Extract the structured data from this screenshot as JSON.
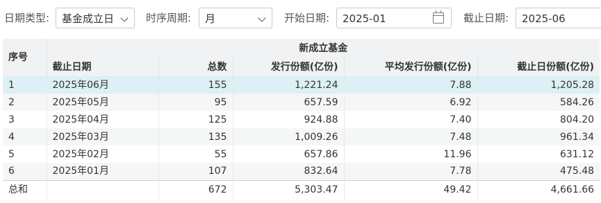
{
  "filters": {
    "date_type_label": "日期类型:",
    "date_type_value": "基金成立日",
    "period_label": "时序周期:",
    "period_value": "月",
    "start_label": "开始日期:",
    "start_value": "2025-01",
    "end_label": "截止日期:",
    "end_value": "2025-06"
  },
  "table": {
    "seq_header": "序号",
    "group_header": "新成立基金",
    "columns": [
      "截止日期",
      "总数",
      "发行份额(亿份)",
      "平均发行份额(亿份)",
      "截止日份额(亿份)"
    ],
    "rows": [
      {
        "seq": "1",
        "date": "2025年06月",
        "total": "155",
        "issue": "1,221.24",
        "avg": "7.88",
        "end": "1,205.28"
      },
      {
        "seq": "2",
        "date": "2025年05月",
        "total": "95",
        "issue": "657.59",
        "avg": "6.92",
        "end": "584.26"
      },
      {
        "seq": "3",
        "date": "2025年04月",
        "total": "125",
        "issue": "924.88",
        "avg": "7.40",
        "end": "804.20"
      },
      {
        "seq": "4",
        "date": "2025年03月",
        "total": "135",
        "issue": "1,009.26",
        "avg": "7.48",
        "end": "961.34"
      },
      {
        "seq": "5",
        "date": "2025年02月",
        "total": "55",
        "issue": "657.86",
        "avg": "11.96",
        "end": "631.12"
      },
      {
        "seq": "6",
        "date": "2025年01月",
        "total": "107",
        "issue": "832.64",
        "avg": "7.78",
        "end": "475.48"
      }
    ],
    "footer": {
      "label": "总和",
      "total": "672",
      "issue": "5,303.47",
      "avg": "49.42",
      "end": "4,661.66"
    }
  },
  "colors": {
    "selected_row": "#dcf0f6",
    "header_bg": "#f0f2f4"
  }
}
